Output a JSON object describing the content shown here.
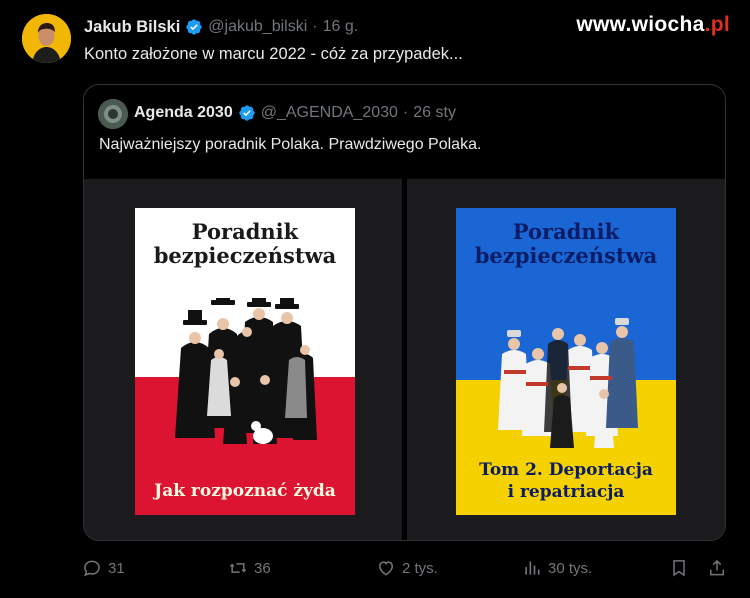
{
  "watermark": "www.wiocha.pl",
  "tweet": {
    "author_name": "Jakub Bilski",
    "author_handle": "@jakub_bilski",
    "separator": "·",
    "time": "16 g.",
    "text": "Konto założone w marcu 2022 - cóż za przypadek..."
  },
  "quoted": {
    "author_name": "Agenda 2030",
    "author_handle": "@_AGENDA_2030",
    "separator": "·",
    "time": "26 sty",
    "text": "Najważniejszy poradnik Polaka. Prawdziwego Polaka.",
    "images": [
      {
        "title_line1": "Poradnik",
        "title_line2": "bezpieczeństwa",
        "subtitle_line1": "Jak rozpoznać żyda",
        "colors": [
          "#ffffff",
          "#dc1431"
        ]
      },
      {
        "title_line1": "Poradnik",
        "title_line2": "bezpieczeństwa",
        "subtitle_line1": "Tom 2. Deportacja",
        "subtitle_line2": "i repatriacja",
        "colors": [
          "#1a66d4",
          "#f5d100"
        ]
      }
    ]
  },
  "actions": {
    "replies": "31",
    "reposts": "36",
    "likes": "2 tys.",
    "views": "30 tys."
  },
  "colors": {
    "background": "#000000",
    "text": "#e7e9ea",
    "muted": "#71767b",
    "verified": "#1d9bf0",
    "border": "#2f3336"
  },
  "icons": [
    "verified-badge-icon",
    "reply-icon",
    "repost-icon",
    "like-icon",
    "views-icon",
    "bookmark-icon",
    "share-icon"
  ]
}
